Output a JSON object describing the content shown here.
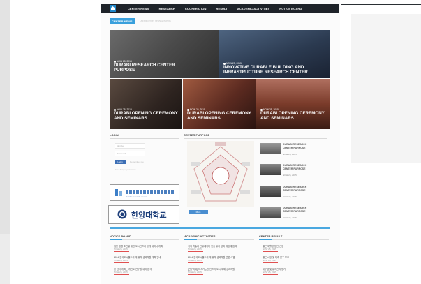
{
  "nav": {
    "items": [
      "CENTER NEWS",
      "RESEARCH",
      "COOPERATION",
      "RESULT",
      "ACADEMIC ACTIVITIES",
      "NOTICE BOARD"
    ]
  },
  "section": {
    "tag": "CENTER NEWS",
    "breadcrumb": "Durabi center news & events"
  },
  "tiles": [
    {
      "date": "NOW 25, 2015",
      "title": "DURABI RESEARCH CENTER PURPOSE",
      "bg": "#585858"
    },
    {
      "date": "NOW 25, 2015",
      "title": "INNOVATIVE DURABLE BUILDING AND INFRASTRUCTURE RESEARCH CENTER",
      "bg": "#2e3c52"
    },
    {
      "date": "NOW 25, 2015",
      "title": "DURABI OPENING CEREMONY AND SEMINARS",
      "bg": "#3a2a22"
    },
    {
      "date": "NOW 25, 2015",
      "title": "DURABI OPENING CEREMONY AND SEMINARS",
      "bg": "#6b2f22"
    },
    {
      "date": "NOW 25, 2015",
      "title": "DURABI OPENING CEREMONY AND SEMINARS",
      "bg": "#7a3b2a"
    }
  ],
  "login": {
    "title": "LOGIN",
    "id_placeholder": "Member",
    "pw_placeholder": "Password",
    "button": "Login",
    "remember": "Remember me",
    "links": "Join / Forgot password"
  },
  "banners": {
    "partner": "Durabi research center",
    "university": "한양대학교"
  },
  "center_purpose": {
    "title": "CENTER PURPOSE",
    "button": "More"
  },
  "side_news": [
    {
      "title": "DURABI RESEARCH CENTER PURPOSE",
      "date": "NOW 25, 2015"
    },
    {
      "title": "DURABI RESEARCH CENTER PURPOSE",
      "date": "NOW 25, 2015"
    },
    {
      "title": "DURABI RESEARCH CENTER PURPOSE",
      "date": "NOW 25, 2015"
    },
    {
      "title": "DURABI RESEARCH CENTER PURPOSE",
      "date": "NOW 25, 2015"
    }
  ],
  "columns": {
    "notice": {
      "title": "NOTICE BOARD",
      "items": [
        {
          "title": "첨단 환경 조건을 위한 도시인프라 공개 세미나 개최",
          "date": "NOW 25, 2015"
        },
        {
          "title": "2014 한국도시철도의 재 유지 성과지원 개최 안내",
          "date": "NOW 25, 2015"
        },
        {
          "title": "한 센터 개최는 개전도 연구원 세미 참석",
          "date": "NOW 25, 2015"
        }
      ]
    },
    "academic": {
      "title": "ACADEMIC ACTIVITIES",
      "items": [
        {
          "title": "국외 학술회 인큐베이터 인증 유지 성과 계정에 참여",
          "date": "NOW 25, 2015"
        },
        {
          "title": "2014 한국도시철도의 재 유지 성과지원 관련 사업",
          "date": "NOW 25, 2015"
        },
        {
          "title": "[연구과제] 지속가능한 인프라 도시 재해 성과지원",
          "date": "NOW 25, 2015"
        }
      ]
    },
    "result": {
      "title": "CENTER RESULT",
      "items": [
        {
          "title": "철근 재활용 방안 선정",
          "date": "NOW 25, 2015"
        },
        {
          "title": "철근 시장 및 미래 연구 보고",
          "date": "NOW 25, 2015"
        },
        {
          "title": "내구성 및 유지관리 평가",
          "date": "NOW 25, 2015"
        }
      ]
    }
  },
  "colors": {
    "accent": "#3aa0dc",
    "nav": "#1e2329",
    "mark": "#e05050"
  }
}
